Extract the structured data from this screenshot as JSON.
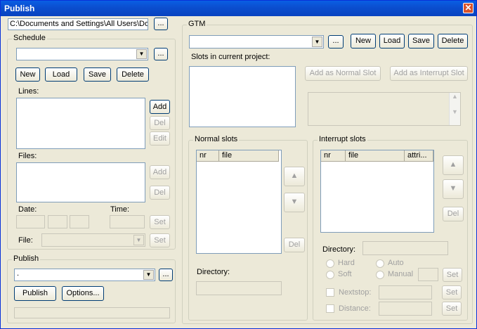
{
  "title": "Publish",
  "path_value": "C:\\Documents and Settings\\All Users\\Do",
  "browse_label": "...",
  "schedule": {
    "group_label": "Schedule",
    "new": "New",
    "load": "Load",
    "save": "Save",
    "delete": "Delete",
    "lines_label": "Lines:",
    "files_label": "Files:",
    "add": "Add",
    "del": "Del",
    "edit": "Edit",
    "date_label": "Date:",
    "time_label": "Time:",
    "set": "Set",
    "file_label": "File:"
  },
  "publish": {
    "group_label": "Publish",
    "combo_value": ".",
    "publish_btn": "Publish",
    "options_btn": "Options..."
  },
  "gtm": {
    "group_label": "GTM",
    "new": "New",
    "load": "Load",
    "save": "Save",
    "delete": "Delete",
    "slots_label": "Slots in current project:",
    "add_normal": "Add as Normal Slot",
    "add_interrupt": "Add as Interrupt Slot",
    "normal_label": "Normal slots",
    "interrupt_label": "Interrupt slots",
    "col_nr": "nr",
    "col_file": "file",
    "col_attri": "attri...",
    "del": "Del",
    "directory_label": "Directory:",
    "hard": "Hard",
    "soft": "Soft",
    "auto": "Auto",
    "manual": "Manual",
    "set": "Set",
    "nextstop": "Nextstop:",
    "distance": "Distance:"
  }
}
